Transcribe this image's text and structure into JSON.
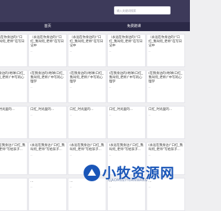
{
  "search": {
    "placeholder": "输入关键词搜索"
  },
  "nav": {
    "items": [
      "首页",
      "免费蹭课"
    ]
  },
  "colors": {
    "topbar": "#3d3a5a",
    "nav": "#2b2947",
    "watermark": "#1a56b8"
  },
  "cards": [
    [
      {
        "title": "（永远在你身边的)“口红_我叫何_老师”在写日记中",
        "excerpt": "...",
        "date": ""
      },
      {
        "title": "(在我身边的)地球(口红_我叫何_老师)”中写的心理学",
        "excerpt": "...",
        "date": ""
      },
      {
        "title": "口红_时光里的...",
        "excerpt": "...",
        "date": ""
      },
      {
        "title": "(永远在我身边)“口红_我叫何_老师”写给孩子...",
        "excerpt": "...",
        "date": ""
      },
      {
        "title": "...",
        "excerpt": "...",
        "date": ""
      }
    ]
  ],
  "watermark": {
    "text": "小牧资源网",
    "sub": "XIAOMUZIYUANWANG"
  }
}
